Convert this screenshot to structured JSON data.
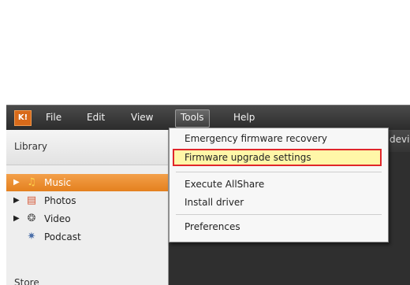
{
  "menubar": {
    "logo": "K!",
    "items": [
      "File",
      "Edit",
      "View",
      "Tools",
      "Help"
    ],
    "active": "Tools"
  },
  "sidebar": {
    "header": "Library",
    "items": [
      {
        "label": "Music",
        "icon": "music-icon",
        "selected": true
      },
      {
        "label": "Photos",
        "icon": "photos-icon",
        "selected": false
      },
      {
        "label": "Video",
        "icon": "video-icon",
        "selected": false
      },
      {
        "label": "Podcast",
        "icon": "podcast-icon",
        "selected": false
      }
    ],
    "store_label": "Store"
  },
  "content": {
    "device_tab": "devic"
  },
  "tools_menu": {
    "items": [
      "Emergency firmware recovery",
      "Firmware upgrade settings",
      "Execute AllShare",
      "Install driver",
      "Preferences"
    ],
    "highlighted": "Firmware upgrade settings"
  },
  "colors": {
    "selection_orange": "#e4801e",
    "highlight_yellow": "#fff7a8",
    "highlight_border": "#e0262a"
  }
}
